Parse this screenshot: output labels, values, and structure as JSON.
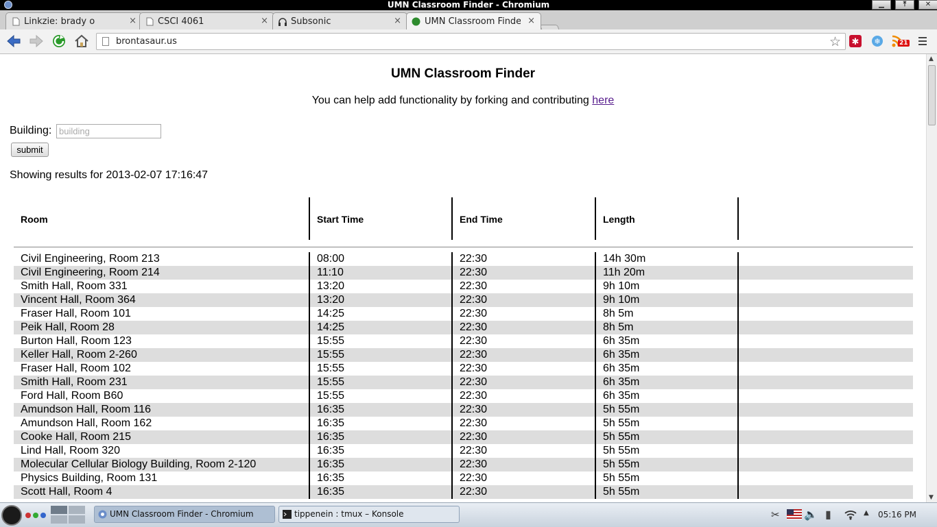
{
  "window": {
    "title": "UMN Classroom Finder - Chromium"
  },
  "tabs": [
    {
      "label": "Linkzie: brady o",
      "close": "×"
    },
    {
      "label": "CSCI 4061",
      "close": "×"
    },
    {
      "label": "Subsonic",
      "close": "×"
    },
    {
      "label": "UMN Classroom Finder",
      "close": "×"
    }
  ],
  "toolbar": {
    "url": "brontasaur.us",
    "rss_badge": "21"
  },
  "page": {
    "title": "UMN Classroom Finder",
    "contrib_text": "You can help add functionality by forking and contributing ",
    "contrib_link": "here",
    "building_label": "Building:",
    "building_placeholder": "building",
    "submit_label": "submit",
    "results_text": "Showing results for 2013-02-07 17:16:47",
    "table": {
      "headers": [
        "Room",
        "Start Time",
        "End Time",
        "Length"
      ],
      "rows": [
        [
          "Civil Engineering, Room 213",
          "08:00",
          "22:30",
          "14h 30m"
        ],
        [
          "Civil Engineering, Room 214",
          "11:10",
          "22:30",
          "11h 20m"
        ],
        [
          "Smith Hall, Room 331",
          "13:20",
          "22:30",
          "9h 10m"
        ],
        [
          "Vincent Hall, Room 364",
          "13:20",
          "22:30",
          "9h 10m"
        ],
        [
          "Fraser Hall, Room 101",
          "14:25",
          "22:30",
          "8h 5m"
        ],
        [
          "Peik Hall, Room 28",
          "14:25",
          "22:30",
          "8h 5m"
        ],
        [
          "Burton Hall, Room 123",
          "15:55",
          "22:30",
          "6h 35m"
        ],
        [
          "Keller Hall, Room 2-260",
          "15:55",
          "22:30",
          "6h 35m"
        ],
        [
          "Fraser Hall, Room 102",
          "15:55",
          "22:30",
          "6h 35m"
        ],
        [
          "Smith Hall, Room 231",
          "15:55",
          "22:30",
          "6h 35m"
        ],
        [
          "Ford Hall, Room B60",
          "15:55",
          "22:30",
          "6h 35m"
        ],
        [
          "Amundson Hall, Room 116",
          "16:35",
          "22:30",
          "5h 55m"
        ],
        [
          "Amundson Hall, Room 162",
          "16:35",
          "22:30",
          "5h 55m"
        ],
        [
          "Cooke Hall, Room 215",
          "16:35",
          "22:30",
          "5h 55m"
        ],
        [
          "Lind Hall, Room 320",
          "16:35",
          "22:30",
          "5h 55m"
        ],
        [
          "Molecular Cellular Biology Building, Room 2-120",
          "16:35",
          "22:30",
          "5h 55m"
        ],
        [
          "Physics Building, Room 131",
          "16:35",
          "22:30",
          "5h 55m"
        ],
        [
          "Scott Hall, Room 4",
          "16:35",
          "22:30",
          "5h 55m"
        ]
      ]
    }
  },
  "taskbar": {
    "tasks": [
      {
        "label": "UMN Classroom Finder - Chromium"
      },
      {
        "label": "tippenein : tmux – Konsole"
      }
    ],
    "clock": "05:16 PM"
  },
  "colors": {
    "row_alt": "#dddddd",
    "link": "#551a8b",
    "reload_green": "#2a9a2a",
    "nav_blue": "#3b6cc4"
  }
}
